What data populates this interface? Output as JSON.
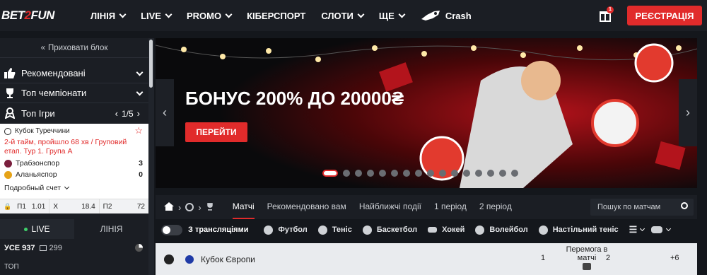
{
  "header": {
    "logo": {
      "left": "BET",
      "mid": "2",
      "right": "FUN"
    },
    "nav": [
      {
        "label": "ЛІНІЯ",
        "dropdown": true
      },
      {
        "label": "LIVE",
        "dropdown": true
      },
      {
        "label": "PROMO",
        "dropdown": true
      },
      {
        "label": "КІБЕРСПОРТ",
        "dropdown": false
      },
      {
        "label": "СЛОТИ",
        "dropdown": true
      },
      {
        "label": "ЩЕ",
        "dropdown": true
      }
    ],
    "crash_label": "Crash",
    "gift_count": "1",
    "register_label": "РЕЄСТРАЦІЯ",
    "accent": "#e12b2b"
  },
  "sidebar": {
    "hide_label": "Приховати блок",
    "recommended": "Рекомендовані",
    "top_championships": "Топ чемпіонати",
    "top_games": "Топ Ігри",
    "top_games_page": "1/5",
    "match": {
      "league": "Кубок Туреччини",
      "status": "2-й тайм, пройшло 68 хв / Груповий етап. Тур 1. Група A",
      "team1": "Трабзонспор",
      "score1": "3",
      "team2": "Аланьяспор",
      "score2": "0",
      "detail": "Подробный счет",
      "odds": [
        {
          "label": "П1",
          "value": "1.01"
        },
        {
          "label": "X",
          "value": "18.4"
        },
        {
          "label": "П2",
          "value": "72"
        }
      ]
    },
    "tabs": {
      "live": "LIVE",
      "line": "ЛІНІЯ"
    },
    "all_label": "УСЕ 937",
    "all_count": "299",
    "top_label": "ТОП"
  },
  "banner": {
    "title": "БОНУС 200% ДО 20000₴",
    "button": "ПЕРЕЙТИ",
    "slides": 16,
    "active_slide": 0
  },
  "filter": {
    "tabs": [
      {
        "label": "Матчі",
        "active": true
      },
      {
        "label": "Рекомендовано вам",
        "active": false
      },
      {
        "label": "Найближчі події",
        "active": false
      },
      {
        "label": "1 період",
        "active": false
      },
      {
        "label": "2 період",
        "active": false
      }
    ],
    "search_placeholder": "Пошук по матчам"
  },
  "sports": {
    "streams_label": "З трансляціями",
    "items": [
      "Футбол",
      "Теніс",
      "Баскетбол",
      "Хокей",
      "Волейбол",
      "Настільний теніс"
    ]
  },
  "league_row": {
    "name": "Кубок Європи",
    "col1": "1",
    "market": "Перемога в матчі",
    "col2": "2",
    "more": "+6"
  }
}
